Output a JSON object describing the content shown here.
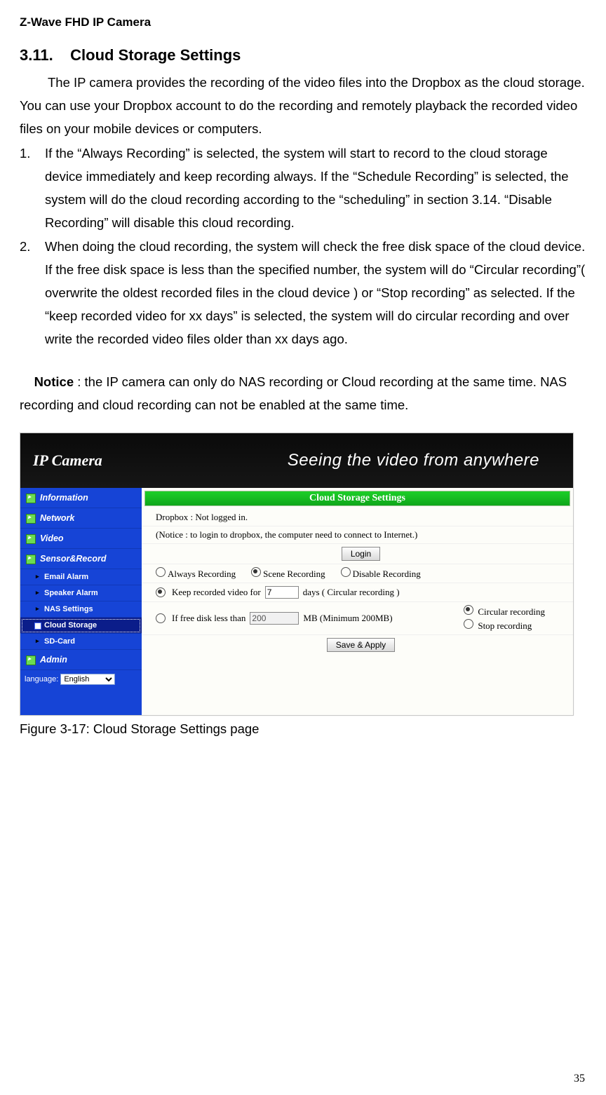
{
  "doc_header": "Z-Wave FHD IP Camera",
  "section_number": "3.11.",
  "section_title": "Cloud Storage Settings",
  "intro": "The IP camera provides the recording of the video files into the Dropbox as the cloud storage. You can use your Dropbox account to do the recording and remotely playback the recorded video files on your mobile devices or computers.",
  "list": {
    "item1": "If the “Always Recording” is selected, the system will start to record to the cloud storage device immediately and keep recording always. If the “Schedule Recording” is selected, the system will do the cloud recording according to the “scheduling” in section 3.14. “Disable Recording” will disable this cloud recording.",
    "item2": "When doing the cloud recording, the system will check the free disk space of the cloud device. If the free disk space is less than the specified number, the system will do “Circular recording”( overwrite the oldest recorded files in the cloud device ) or “Stop recording” as selected. If the “keep recorded video for xx days” is selected, the system will do circular recording and over write the recorded video files older than xx days ago."
  },
  "notice_label": "Notice",
  "notice_text": " : the IP camera can only do NAS recording or Cloud recording at the same time. NAS recording and cloud recording can not be enabled at the same time.",
  "figure_caption": "Figure 3-17: Cloud Storage Settings page",
  "page_number": "35",
  "app": {
    "logo": "IP Camera",
    "tagline": "Seeing the video from anywhere",
    "sidebar": {
      "info": "Information",
      "network": "Network",
      "video": "Video",
      "sensor": "Sensor&Record",
      "email": "Email Alarm",
      "speaker": "Speaker Alarm",
      "nas": "NAS Settings",
      "cloud": "Cloud Storage",
      "sd": "SD-Card",
      "admin": "Admin",
      "language_label": "language:",
      "language_value": "English"
    },
    "panel": {
      "title": "Cloud Storage Settings",
      "dropbox_label": "Dropbox  :   Not logged in.",
      "notice": "(Notice : to login to dropbox, the computer need to connect to Internet.)",
      "login_btn": "Login",
      "opt_always": "Always Recording",
      "opt_scene": "Scene Recording",
      "opt_disable": "Disable Recording",
      "keep_label_pre": "Keep recorded video for",
      "keep_days_value": "7",
      "keep_label_post": "days ( Circular recording )",
      "freedisk_pre": "If free disk less than",
      "freedisk_value": "200",
      "freedisk_post": "MB (Minimum 200MB)",
      "circular": "Circular recording",
      "stop": "Stop recording",
      "save_btn": "Save & Apply"
    }
  }
}
